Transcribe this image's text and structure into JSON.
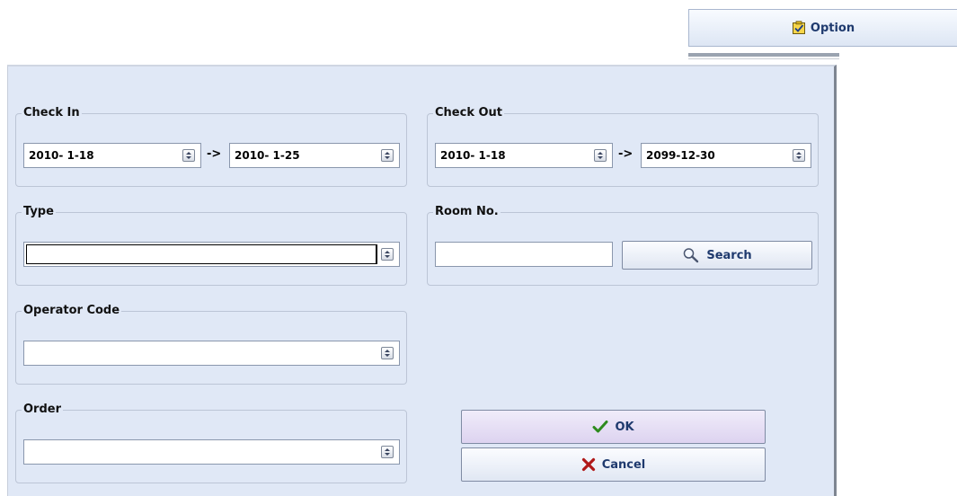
{
  "option_button": {
    "label": "Option"
  },
  "check_in": {
    "title": "Check In",
    "from": "2010- 1-18",
    "to": "2010- 1-25"
  },
  "check_out": {
    "title": "Check Out",
    "from": "2010- 1-18",
    "to": "2099-12-30"
  },
  "range_arrow": "->",
  "type": {
    "title": "Type",
    "value": ""
  },
  "room_no": {
    "title": "Room No.",
    "value": "",
    "search_label": "Search"
  },
  "operator_code": {
    "title": "Operator Code",
    "value": ""
  },
  "order": {
    "title": "Order",
    "value": ""
  },
  "actions": {
    "ok_label": "OK",
    "cancel_label": "Cancel"
  },
  "colors": {
    "panel_bg": "#e0e8f6",
    "ok_bg": "#e6e0f4",
    "ok_icon": "#2e8b1e",
    "cancel_icon": "#b01818"
  }
}
